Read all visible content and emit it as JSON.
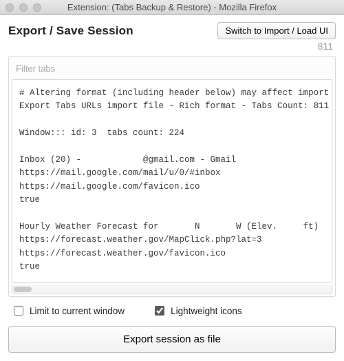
{
  "window": {
    "title": "Extension: (Tabs Backup & Restore) - Mozilla Firefox"
  },
  "header": {
    "title": "Export / Save Session",
    "switch_label": "Switch to Import / Load UI",
    "tab_count": "811"
  },
  "filter": {
    "placeholder": "Filter tabs"
  },
  "export_text": "# Altering format (including header below) may affect import\nExport Tabs URLs import file - Rich format - Tabs Count: 811\n\nWindow::: id: 3  tabs count: 224\n\nInbox (20) -            @gmail.com - Gmail\nhttps://mail.google.com/mail/u/0/#inbox\nhttps://mail.google.com/favicon.ico\ntrue\n\nHourly Weather Forecast for       N       W (Elev.     ft)\nhttps://forecast.weather.gov/MapClick.php?lat=3\nhttps://forecast.weather.gov/favicon.ico\ntrue\n\nDes Moines, NM Monthly Weather Forecast - weather.com",
  "options": {
    "limit_label": "Limit to current window",
    "limit_checked": false,
    "lightweight_label": "Lightweight icons",
    "lightweight_checked": true
  },
  "footer": {
    "export_label": "Export session as file"
  }
}
